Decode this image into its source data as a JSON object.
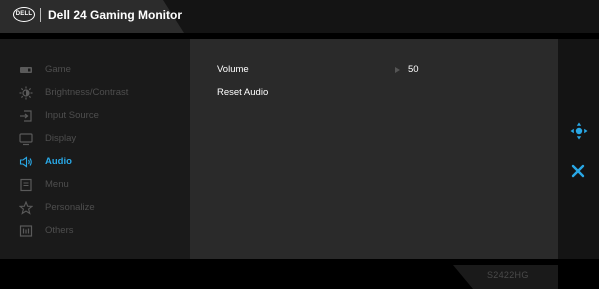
{
  "header": {
    "logo_text": "DELL",
    "title": "Dell 24 Gaming Monitor"
  },
  "menu": {
    "items": [
      {
        "label": "Game",
        "icon": "game-icon",
        "active": false
      },
      {
        "label": "Brightness/Contrast",
        "icon": "brightness-icon",
        "active": false
      },
      {
        "label": "Input Source",
        "icon": "input-source-icon",
        "active": false
      },
      {
        "label": "Display",
        "icon": "display-icon",
        "active": false
      },
      {
        "label": "Audio",
        "icon": "audio-icon",
        "active": true
      },
      {
        "label": "Menu",
        "icon": "menu-icon",
        "active": false
      },
      {
        "label": "Personalize",
        "icon": "star-icon",
        "active": false
      },
      {
        "label": "Others",
        "icon": "others-icon",
        "active": false
      }
    ]
  },
  "audio": {
    "volume_label": "Volume",
    "volume_value": "50",
    "reset_label": "Reset Audio"
  },
  "controls": {
    "nav_icon": "joystick-nav-icon",
    "close_icon": "close-icon"
  },
  "footer": {
    "model": "S2422HG"
  },
  "colors": {
    "accent": "#29a8e6",
    "inactive_text": "#4e4e4e",
    "panel_left": "#1a1a1a",
    "panel_center": "#2a2a2a"
  }
}
